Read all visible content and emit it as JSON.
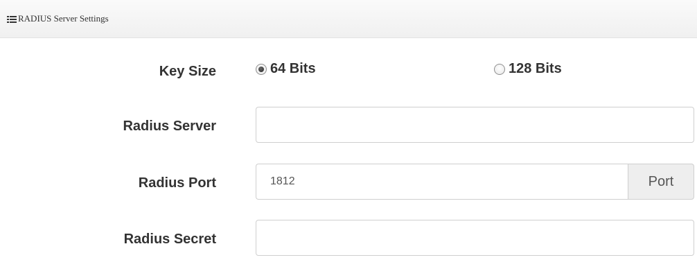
{
  "panel": {
    "title": "RADIUS Server Settings",
    "icon": "list-icon"
  },
  "form": {
    "key_size": {
      "label": "Key Size",
      "options": [
        {
          "label": "64 Bits",
          "selected": true
        },
        {
          "label": "128 Bits",
          "selected": false
        }
      ]
    },
    "radius_server": {
      "label": "Radius Server",
      "value": ""
    },
    "radius_port": {
      "label": "Radius Port",
      "value": "1812",
      "addon": "Port"
    },
    "radius_secret": {
      "label": "Radius Secret",
      "value": ""
    }
  }
}
